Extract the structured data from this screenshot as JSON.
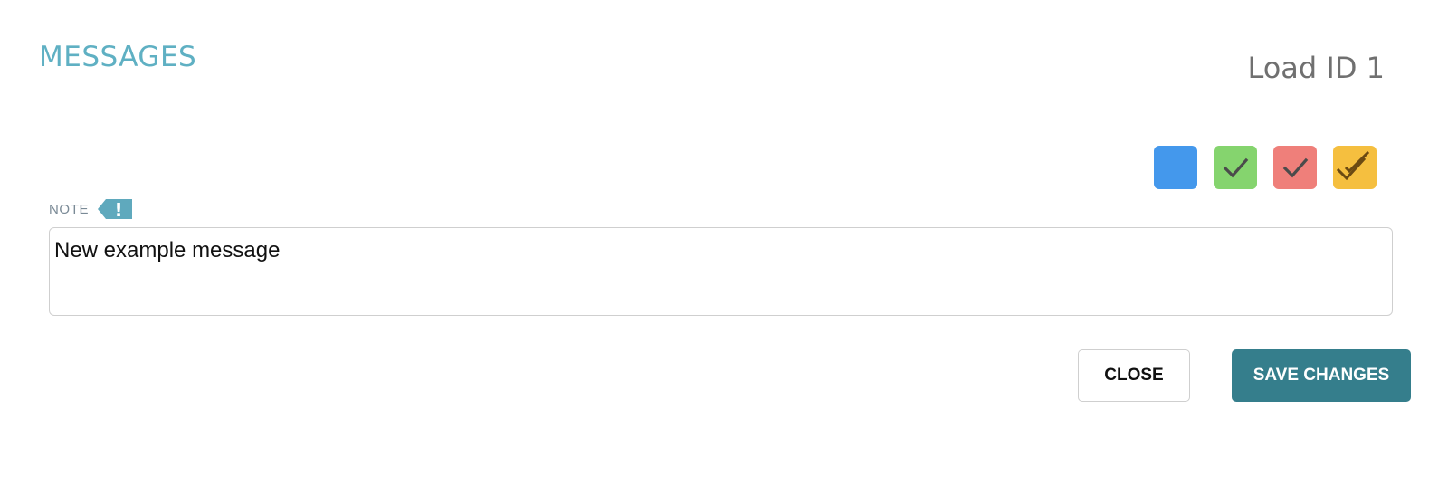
{
  "dialog": {
    "title": "MESSAGES",
    "load_id": "Load ID 1"
  },
  "colors": {
    "title": "#5fb0c3",
    "accent": "#357e8c",
    "badge": "#5fa9bd"
  },
  "swatches": [
    {
      "name": "blue",
      "color": "#4498ec",
      "icon": "none"
    },
    {
      "name": "green",
      "color": "#85d46e",
      "icon": "check-icon"
    },
    {
      "name": "red",
      "color": "#ef7f7a",
      "icon": "check-icon"
    },
    {
      "name": "yellow",
      "color": "#f5bf3f",
      "icon": "double-check-icon"
    }
  ],
  "note": {
    "label": "NOTE",
    "badge_icon": "exclamation-tag-icon",
    "badge_text": "!",
    "value": "New example message"
  },
  "buttons": {
    "close_label": "CLOSE",
    "save_label": "SAVE CHANGES"
  }
}
